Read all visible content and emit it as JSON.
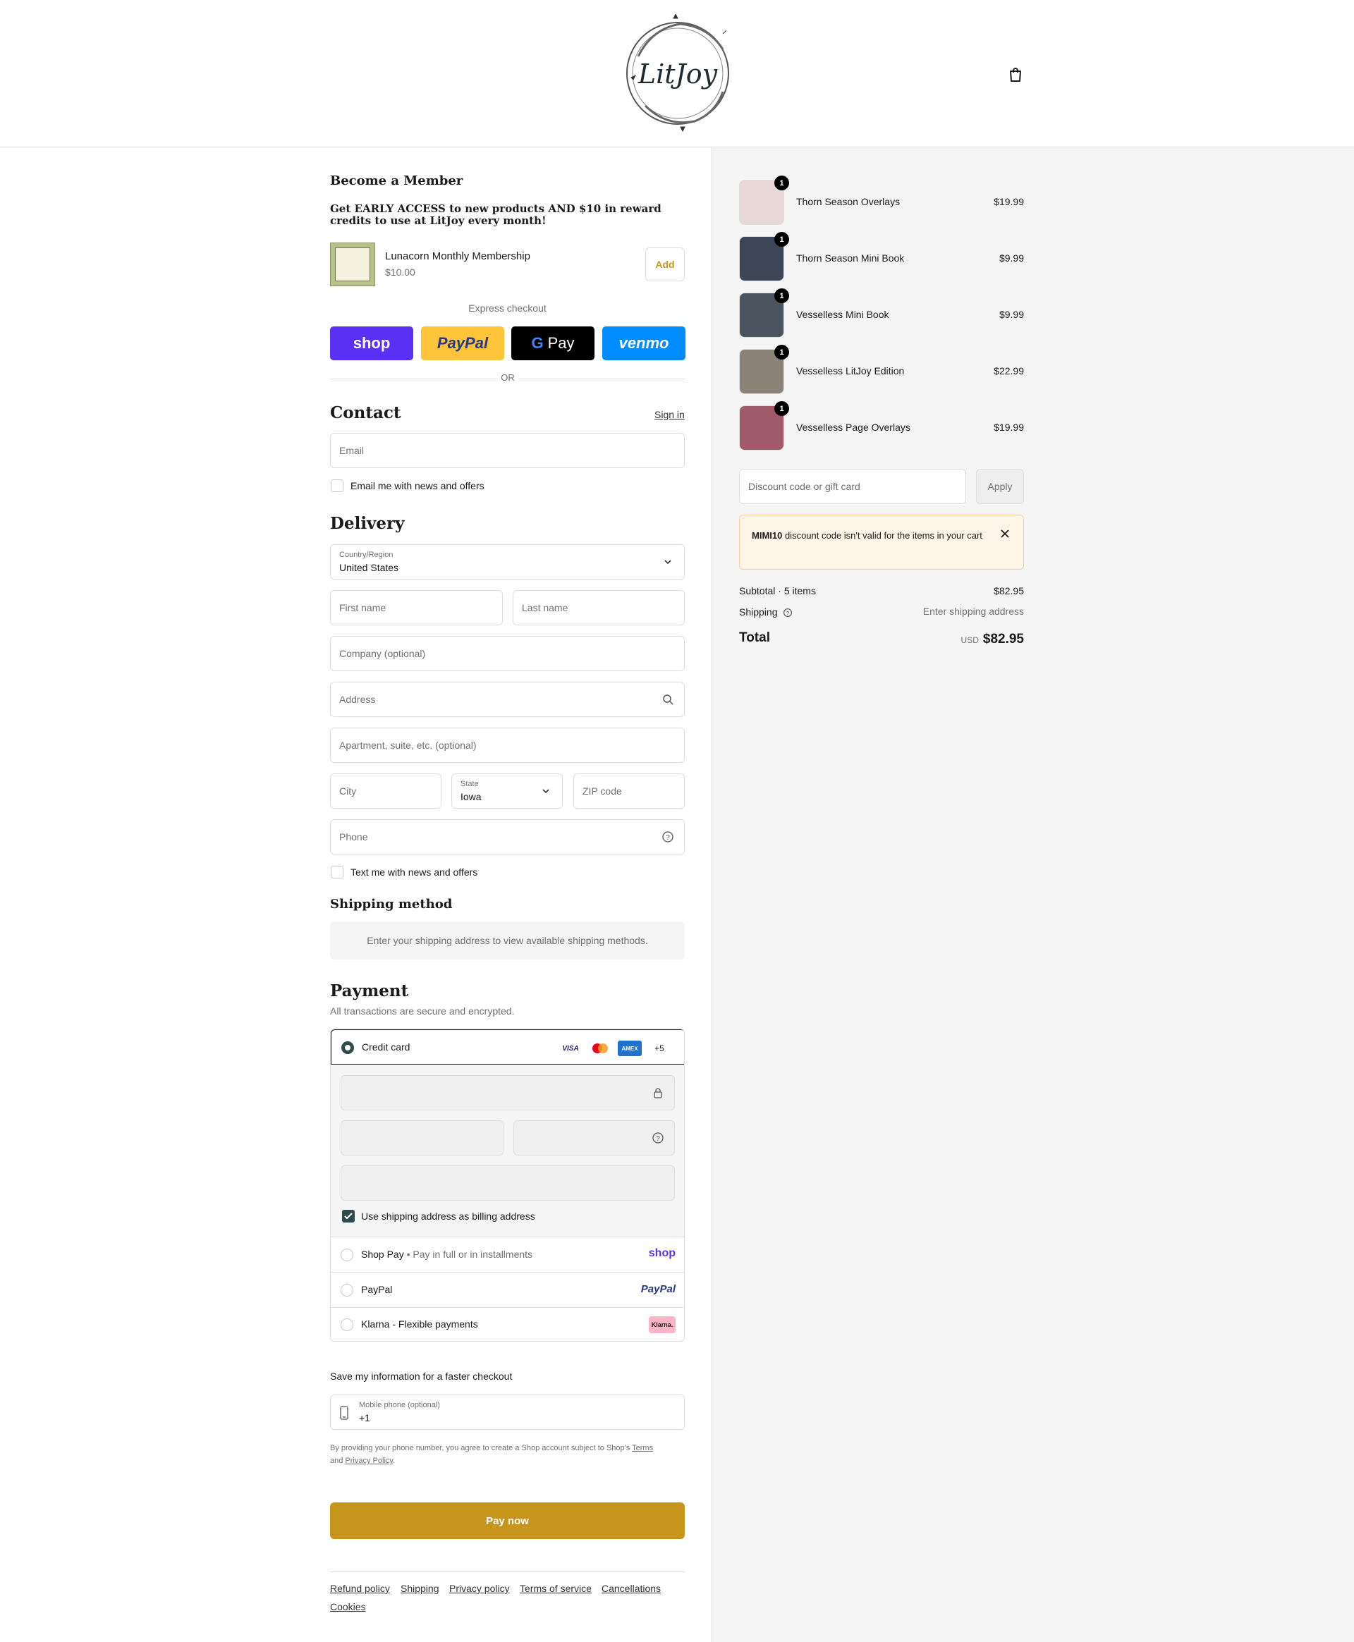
{
  "header": {
    "logo_text": "LitJoy",
    "cart_icon": "shopping-bag-icon"
  },
  "member": {
    "title": "Become a Member",
    "subtitle": "Get EARLY ACCESS to new products AND $10 in reward credits to use at LitJoy every month!",
    "product_name": "Lunacorn Monthly Membership",
    "product_price": "$10.00",
    "add_label": "Add"
  },
  "express": {
    "label": "Express checkout",
    "buttons": [
      "shop",
      "PayPal",
      "Pay",
      "venmo"
    ],
    "or": "OR"
  },
  "contact": {
    "title": "Contact",
    "sign_in": "Sign in",
    "email_placeholder": "Email",
    "news_checkbox": "Email me with news and offers"
  },
  "delivery": {
    "title": "Delivery",
    "country_label": "Country/Region",
    "country_value": "United States",
    "first_name": "First name",
    "last_name": "Last name",
    "company": "Company (optional)",
    "address": "Address",
    "apartment": "Apartment, suite, etc. (optional)",
    "city": "City",
    "state_label": "State",
    "state_value": "Iowa",
    "zip": "ZIP code",
    "phone": "Phone",
    "text_checkbox": "Text me with news and offers"
  },
  "shipping_method": {
    "title": "Shipping method",
    "notice": "Enter your shipping address to view available shipping methods."
  },
  "payment": {
    "title": "Payment",
    "subtitle": "All transactions are secure and encrypted.",
    "credit_card": "Credit card",
    "card_badges": [
      "VISA",
      "",
      "AMEX",
      "+5"
    ],
    "billing_checkbox": "Use shipping address as billing address",
    "shop_pay": "Shop Pay",
    "shop_pay_note": "Pay in full or in installments",
    "shop_logo": "shop",
    "paypal": "PayPal",
    "paypal_logo": "PayPal",
    "klarna": "Klarna - Flexible payments",
    "klarna_logo": "Klarna."
  },
  "save_info": {
    "title": "Save my information for a faster checkout",
    "phone_label": "Mobile phone (optional)",
    "phone_value": "+1",
    "terms_text": "By providing your phone number, you agree to create a Shop account subject to Shop's",
    "terms_link": "Terms",
    "and": "and",
    "privacy_link": "Privacy Policy",
    "period": "."
  },
  "pay_now": "Pay now",
  "footer_links": [
    "Refund policy",
    "Shipping",
    "Privacy policy",
    "Terms of service",
    "Cancellations",
    "Cookies"
  ],
  "cart": {
    "items": [
      {
        "name": "Thorn Season Overlays",
        "price": "$19.99",
        "qty": "1"
      },
      {
        "name": "Thorn Season Mini Book",
        "price": "$9.99",
        "qty": "1"
      },
      {
        "name": "Vesselless Mini Book",
        "price": "$9.99",
        "qty": "1"
      },
      {
        "name": "Vesselless LitJoy Edition",
        "price": "$22.99",
        "qty": "1"
      },
      {
        "name": "Vesselless Page Overlays",
        "price": "$19.99",
        "qty": "1"
      }
    ],
    "discount_placeholder": "Discount code or gift card",
    "apply": "Apply",
    "warning_code": "MIMI10",
    "warning_text": " discount code isn't valid for the items in your cart",
    "subtotal_label": "Subtotal · 5 items",
    "subtotal_value": "$82.95",
    "shipping_label": "Shipping",
    "shipping_value": "Enter shipping address",
    "total_label": "Total",
    "currency": "USD",
    "total_value": "$82.95"
  },
  "colors": {
    "accent": "#c8951c",
    "shop_purple": "#5a31f4",
    "paypal_yellow": "#ffc439",
    "venmo_blue": "#008cff",
    "warning_bg": "#fff4e8"
  }
}
